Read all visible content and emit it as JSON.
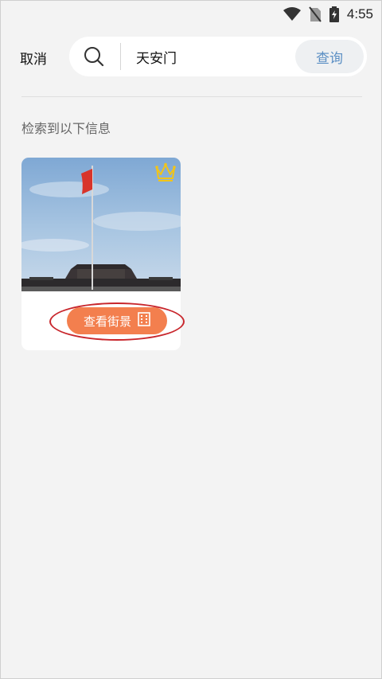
{
  "status_bar": {
    "time": "4:55",
    "icons": [
      "wifi-icon",
      "no-sim-icon",
      "battery-charging-icon"
    ]
  },
  "search": {
    "cancel_label": "取消",
    "query_value": "天安门",
    "submit_label": "查询"
  },
  "results": {
    "heading": "检索到以下信息",
    "items": [
      {
        "image": "tiananmen-flagpole-photo",
        "badge_icon": "crown-icon",
        "action_label": "查看街景",
        "action_icon": "building-icon"
      }
    ]
  },
  "colors": {
    "accent_orange": "#f37f4e",
    "query_blue": "#5b8fc4",
    "highlight_red": "#c8262c",
    "crown_gold": "#f2c418"
  }
}
